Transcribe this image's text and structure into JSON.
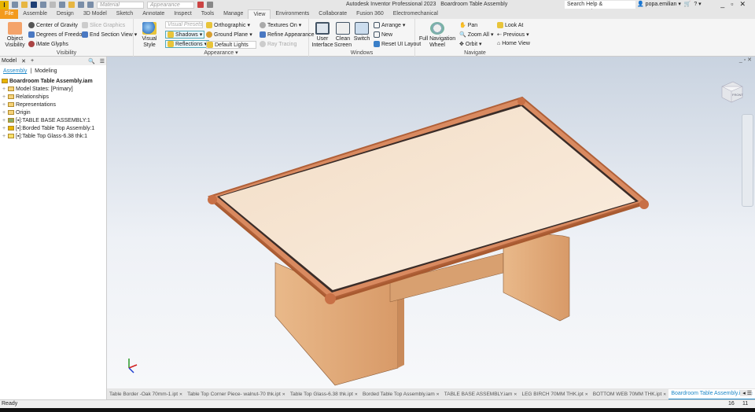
{
  "app": {
    "title": "Autodesk Inventor Professional 2023",
    "document": "Boardroom Table Assembly",
    "logo": "I",
    "material": "Material",
    "appearance": "Appearance",
    "search_placeholder": "Search Help & Commands...",
    "user": "popa.emilian"
  },
  "tabs": [
    "File",
    "Assemble",
    "Design",
    "3D Model",
    "Sketch",
    "Annotate",
    "Inspect",
    "Tools",
    "Manage",
    "View",
    "Environments",
    "Collaborate",
    "Fusion 360",
    "Electromechanical"
  ],
  "active_tab": "View",
  "ribbon": {
    "visibility": {
      "label": "Visibility",
      "object_visibility": "Object Visibility",
      "center_of_gravity": "Center of Gravity",
      "degrees_of_freedom": "Degrees of Freedom",
      "imate_glyphs": "iMate Glyphs",
      "slice_graphics": "Slice Graphics",
      "end_section_view": "End Section View"
    },
    "appearance": {
      "label": "Appearance",
      "visual_style": "Visual Style",
      "visual_presets": "Visual Presets",
      "shadows": "Shadows",
      "reflections": "Reflections",
      "orthographic": "Orthographic",
      "ground_plane": "Ground Plane",
      "default_lights": "Default Lights",
      "textures_on": "Textures On",
      "refine_appearance": "Refine Appearance",
      "ray_tracing": "Ray Tracing"
    },
    "windows": {
      "label": "Windows",
      "user_interface": "User Interface",
      "clean_screen": "Clean Screen",
      "switch": "Switch",
      "arrange": "Arrange",
      "new": "New",
      "reset_ui_layout": "Reset UI Layout"
    },
    "navigate": {
      "label": "Navigate",
      "full_navigation_wheel": "Full Navigation Wheel",
      "pan": "Pan",
      "zoom_all": "Zoom All",
      "orbit": "Orbit",
      "look_at": "Look At",
      "previous": "Previous",
      "home_view": "Home View"
    }
  },
  "browser": {
    "tab": "Model",
    "subtabs": [
      "Assembly",
      "Modeling"
    ],
    "root": "Boardroom Table Assembly.iam",
    "nodes": [
      "Model States: [Primary]",
      "Relationships",
      "Representations",
      "Origin",
      "[▪]:TABLE BASE ASSEMBLY:1",
      "[▪]:Borded Table Top Assembly:1",
      "[▪]:Table Top Glass-6.38 thk:1"
    ]
  },
  "viewcube": {
    "face": "FRONT"
  },
  "doc_tabs": [
    "Table Border -Oak 70mm-1.ipt",
    "Table Top Corner Piece- walnut-70 thk.ipt",
    "Table Top Glass-6.38 thk.ipt",
    "Borded Table Top Assembly.iam",
    "TABLE BASE ASSEMBLY.iam",
    "LEG BIRCH 70MM THK.ipt",
    "BOTTOM WEB 70MM THK.ipt",
    "Boardroom Table Assembly.iam"
  ],
  "status": {
    "text": "Ready",
    "count1": "16",
    "count2": "11"
  }
}
